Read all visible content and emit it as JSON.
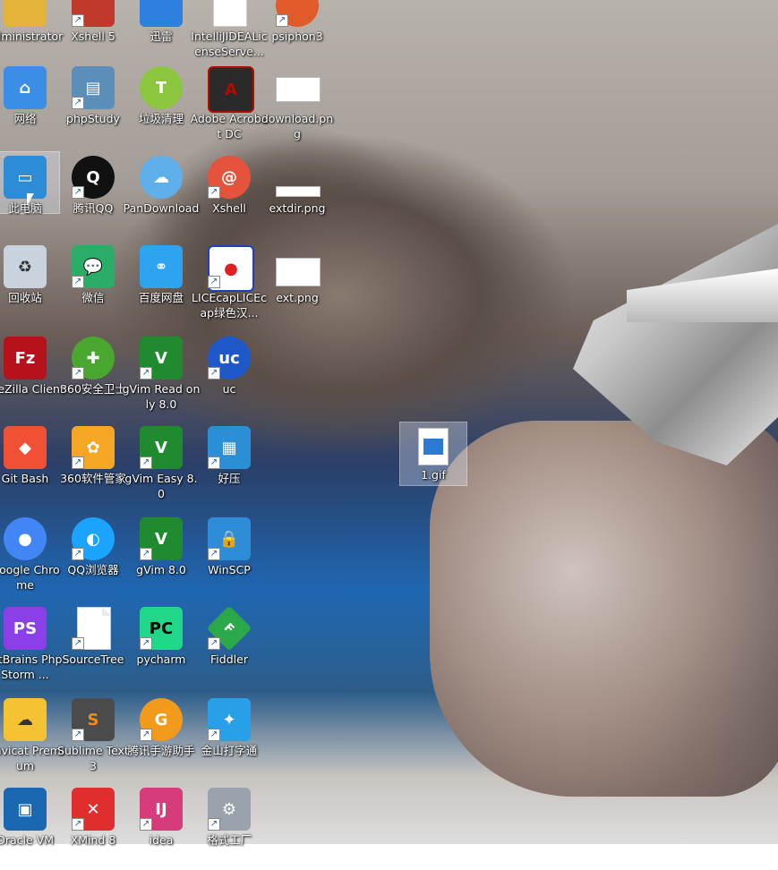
{
  "desktop": {
    "icons": [
      {
        "label": "administrator",
        "icon": "user-folder-icon",
        "color": "#e3b33a"
      },
      {
        "label": "Xshell 5",
        "icon": "xshell-icon",
        "color": "#c0392b"
      },
      {
        "label": "迅雷",
        "icon": "thunder-icon",
        "color": "#2f7fe0"
      },
      {
        "label": "IntelliJIDEALicenseServe...",
        "icon": "file-icon",
        "color": "#ffffff"
      },
      {
        "label": "psiphon3",
        "icon": "psiphon-icon",
        "color": "#e05a2a"
      },
      {
        "label": "网络",
        "icon": "network-icon",
        "color": "#3a8ee6"
      },
      {
        "label": "phpStudy",
        "icon": "phpstudy-icon",
        "color": "#5b8fb9"
      },
      {
        "label": "垃圾清理",
        "icon": "cleaner-icon",
        "color": "#8cc63f"
      },
      {
        "label": "Adobe Acrobat DC",
        "icon": "acrobat-icon",
        "color": "#b30b00"
      },
      {
        "label": "download.png",
        "icon": "image-thumb-icon",
        "color": "#ffffff"
      },
      {
        "label": "此电脑",
        "icon": "computer-icon",
        "color": "#2e8bd6"
      },
      {
        "label": "腾讯QQ",
        "icon": "qq-icon",
        "color": "#111111"
      },
      {
        "label": "PanDownload",
        "icon": "cloud-icon",
        "color": "#5fb0ea"
      },
      {
        "label": "Xshell",
        "icon": "xshell-swirl-icon",
        "color": "#e5533c"
      },
      {
        "label": "extdir.png",
        "icon": "image-thumb-icon",
        "color": "#ffffff"
      },
      {
        "label": "回收站",
        "icon": "recycle-bin-icon",
        "color": "#c9d3dd"
      },
      {
        "label": "微信",
        "icon": "wechat-icon",
        "color": "#2aae67"
      },
      {
        "label": "百度网盘",
        "icon": "baidu-pan-icon",
        "color": "#2ea4f1"
      },
      {
        "label": "LICEcapLICEcap绿色汉...",
        "icon": "licecap-icon",
        "color": "#e02020"
      },
      {
        "label": "ext.png",
        "icon": "image-thumb-icon",
        "color": "#ffffff"
      },
      {
        "label": "FileZilla Client",
        "icon": "filezilla-icon",
        "color": "#b5121b"
      },
      {
        "label": "360安全卫士",
        "icon": "360-security-icon",
        "color": "#49a62f"
      },
      {
        "label": "gVim Read only 8.0",
        "icon": "vim-icon",
        "color": "#1f8a2e"
      },
      {
        "label": "uc",
        "icon": "uc-icon",
        "color": "#1f58c9"
      },
      {
        "label": "Git Bash",
        "icon": "git-icon",
        "color": "#f05033"
      },
      {
        "label": "360软件管家",
        "icon": "360-manager-icon",
        "color": "#f5a623"
      },
      {
        "label": "gVim Easy 8.0",
        "icon": "vim-icon",
        "color": "#1f8a2e"
      },
      {
        "label": "好压",
        "icon": "haozip-icon",
        "color": "#2c8fd6"
      },
      {
        "label": "Google Chrome",
        "icon": "chrome-icon",
        "color": "#4285f4"
      },
      {
        "label": "QQ浏览器",
        "icon": "qq-browser-icon",
        "color": "#1aa3ff"
      },
      {
        "label": "gVim 8.0",
        "icon": "vim-icon",
        "color": "#1f8a2e"
      },
      {
        "label": "WinSCP",
        "icon": "winscp-icon",
        "color": "#2f8dd8"
      },
      {
        "label": "JetBrains PhpStorm ...",
        "icon": "phpstorm-icon",
        "color": "#8b3fe6"
      },
      {
        "label": "SourceTree",
        "icon": "file-icon",
        "color": "#ffffff"
      },
      {
        "label": "pycharm",
        "icon": "pycharm-icon",
        "color": "#21d789"
      },
      {
        "label": "Fiddler",
        "icon": "fiddler-icon",
        "color": "#2aa84a"
      },
      {
        "label": "Navicat Premium",
        "icon": "navicat-icon",
        "color": "#f4c232"
      },
      {
        "label": "Sublime Text 3",
        "icon": "sublime-icon",
        "color": "#f38a1d"
      },
      {
        "label": "腾讯手游助手",
        "icon": "tencent-game-icon",
        "color": "#f29a1c"
      },
      {
        "label": "金山打字通",
        "icon": "typing-icon",
        "color": "#27a0e8"
      },
      {
        "label": "Oracle VM",
        "icon": "virtualbox-icon",
        "color": "#1c67b1"
      },
      {
        "label": "XMind 8",
        "icon": "xmind-icon",
        "color": "#e02d2d"
      },
      {
        "label": "idea",
        "icon": "intellij-icon",
        "color": "#d63b7a"
      },
      {
        "label": "格式工厂",
        "icon": "format-factory-icon",
        "color": "#9aa3ad"
      }
    ],
    "floating_file": {
      "label": "1.gif",
      "icon": "image-file-icon",
      "color": "#2b7bd6"
    }
  }
}
